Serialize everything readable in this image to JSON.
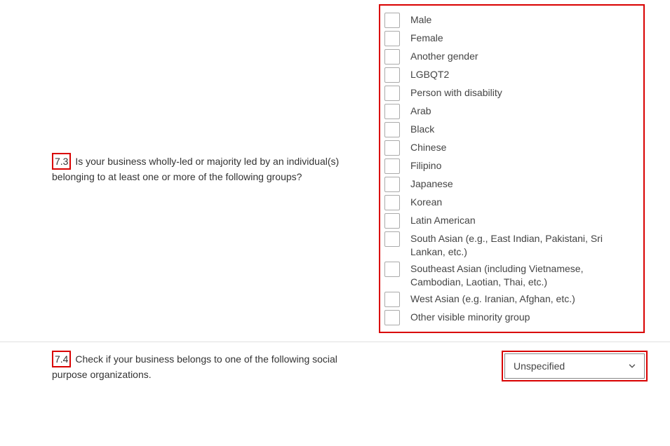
{
  "questions": {
    "q73": {
      "number": "7.3",
      "text": "Is your business wholly-led or majority led by an individual(s) belonging to at least one or more of the following groups?",
      "options": [
        "Male",
        "Female",
        "Another gender",
        "LGBQT2",
        "Person with disability",
        "Arab",
        "Black",
        "Chinese",
        "Filipino",
        "Japanese",
        "Korean",
        "Latin American",
        "South Asian (e.g., East Indian, Pakistani, Sri Lankan, etc.)",
        "Southeast Asian (including Vietnamese, Cambodian, Laotian, Thai, etc.)",
        "West Asian (e.g. Iranian, Afghan, etc.)",
        "Other visible minority group"
      ]
    },
    "q74": {
      "number": "7.4",
      "text": "Check if your business belongs to one of the following social purpose organizations.",
      "selected": "Unspecified"
    }
  }
}
